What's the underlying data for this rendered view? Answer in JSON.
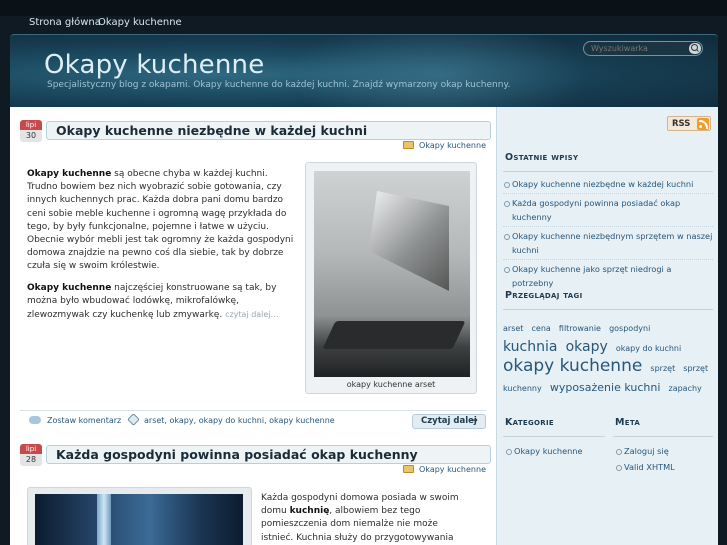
{
  "nav": {
    "home": "Strona główna",
    "category": "Okapy kuchenne"
  },
  "header": {
    "title": "Okapy kuchenne",
    "description": "Specjalistyczny blog z okapami. Okapy kuchenne do każdej kuchni. Znajdź wymarzony okap kuchenny.",
    "search_placeholder": "Wyszukiwarka"
  },
  "posts": [
    {
      "month": "lipi",
      "day": "30",
      "title": "Okapy kuchenne niezbędne w każdej kuchni",
      "category": "Okapy kuchenne",
      "para1_bold": "Okapy kuchenne",
      "para1": " są obecne chyba w każdej kuchni. Trudno bowiem bez nich wyobrazić sobie gotowania, czy innych kuchennych prac. Każda dobra pani domu bardzo ceni sobie meble kuchenne i ogromną wagę przykłada do tego, by były funkcjonalne, pojemne i łatwe w użyciu. Obecnie wybór mebli jest tak ogromny że każda gospodyni domowa znajdzie na pewno coś dla siebie, tak by dobrze czuła się w swoim królestwie.",
      "para2_bold": "Okapy kuchenne",
      "para2": " najczęściej konstruowane są tak, by można było wbudować lodówkę, mikrofalówkę, zlewozmywak czy kuchenkę lub zmywarkę.",
      "more": "czytaj dalej…",
      "image_caption": "okapy kuchenne arset",
      "comments": "Zostaw komentarz",
      "tags": "arset, okapy, okapy do kuchni, okapy kuchenne",
      "read_more": "Czytaj dalej"
    },
    {
      "month": "lipi",
      "day": "28",
      "title": "Każda gospodyni powinna posiadać okap kuchenny",
      "category": "Okapy kuchenne",
      "text_a": "Każda gospodyni domowa posiada w swoim domu ",
      "text_bold": "kuchnię",
      "text_b": ", albowiem bez tego pomieszczenia dom niemalże nie może istnieć. Kuchnia służy do przygotowywania posiłków, spożywania ich,"
    }
  ],
  "sidebar": {
    "rss": "RSS",
    "recent_heading": "Ostatnie wpisy",
    "recent": [
      "Okapy kuchenne niezbędne w każdej kuchni",
      "Każda gospodyni powinna posiadać okap kuchenny",
      "Okapy kuchenne niezbędnym sprzętem w naszej kuchni",
      "Okapy kuchenne jako sprzęt niedrogi a potrzebny"
    ],
    "tags_heading": "Przeglądaj tagi",
    "tags": [
      {
        "label": "arset",
        "size": 8
      },
      {
        "label": "cena",
        "size": 8
      },
      {
        "label": "filtrowanie",
        "size": 8
      },
      {
        "label": "gospodyni",
        "size": 8
      },
      {
        "label": "kuchnia",
        "size": 14
      },
      {
        "label": "okapy",
        "size": 14
      },
      {
        "label": "okapy do kuchni",
        "size": 8
      },
      {
        "label": "okapy kuchenne",
        "size": 17
      },
      {
        "label": "sprzęt",
        "size": 8
      },
      {
        "label": "sprzęt kuchenny",
        "size": 8
      },
      {
        "label": "wyposażenie kuchni",
        "size": 11
      },
      {
        "label": "zapachy",
        "size": 8
      }
    ],
    "categories_heading": "Kategorie",
    "categories": [
      "Okapy kuchenne"
    ],
    "meta_heading": "Meta",
    "meta": [
      "Zaloguj się",
      "Valid XHTML"
    ]
  }
}
